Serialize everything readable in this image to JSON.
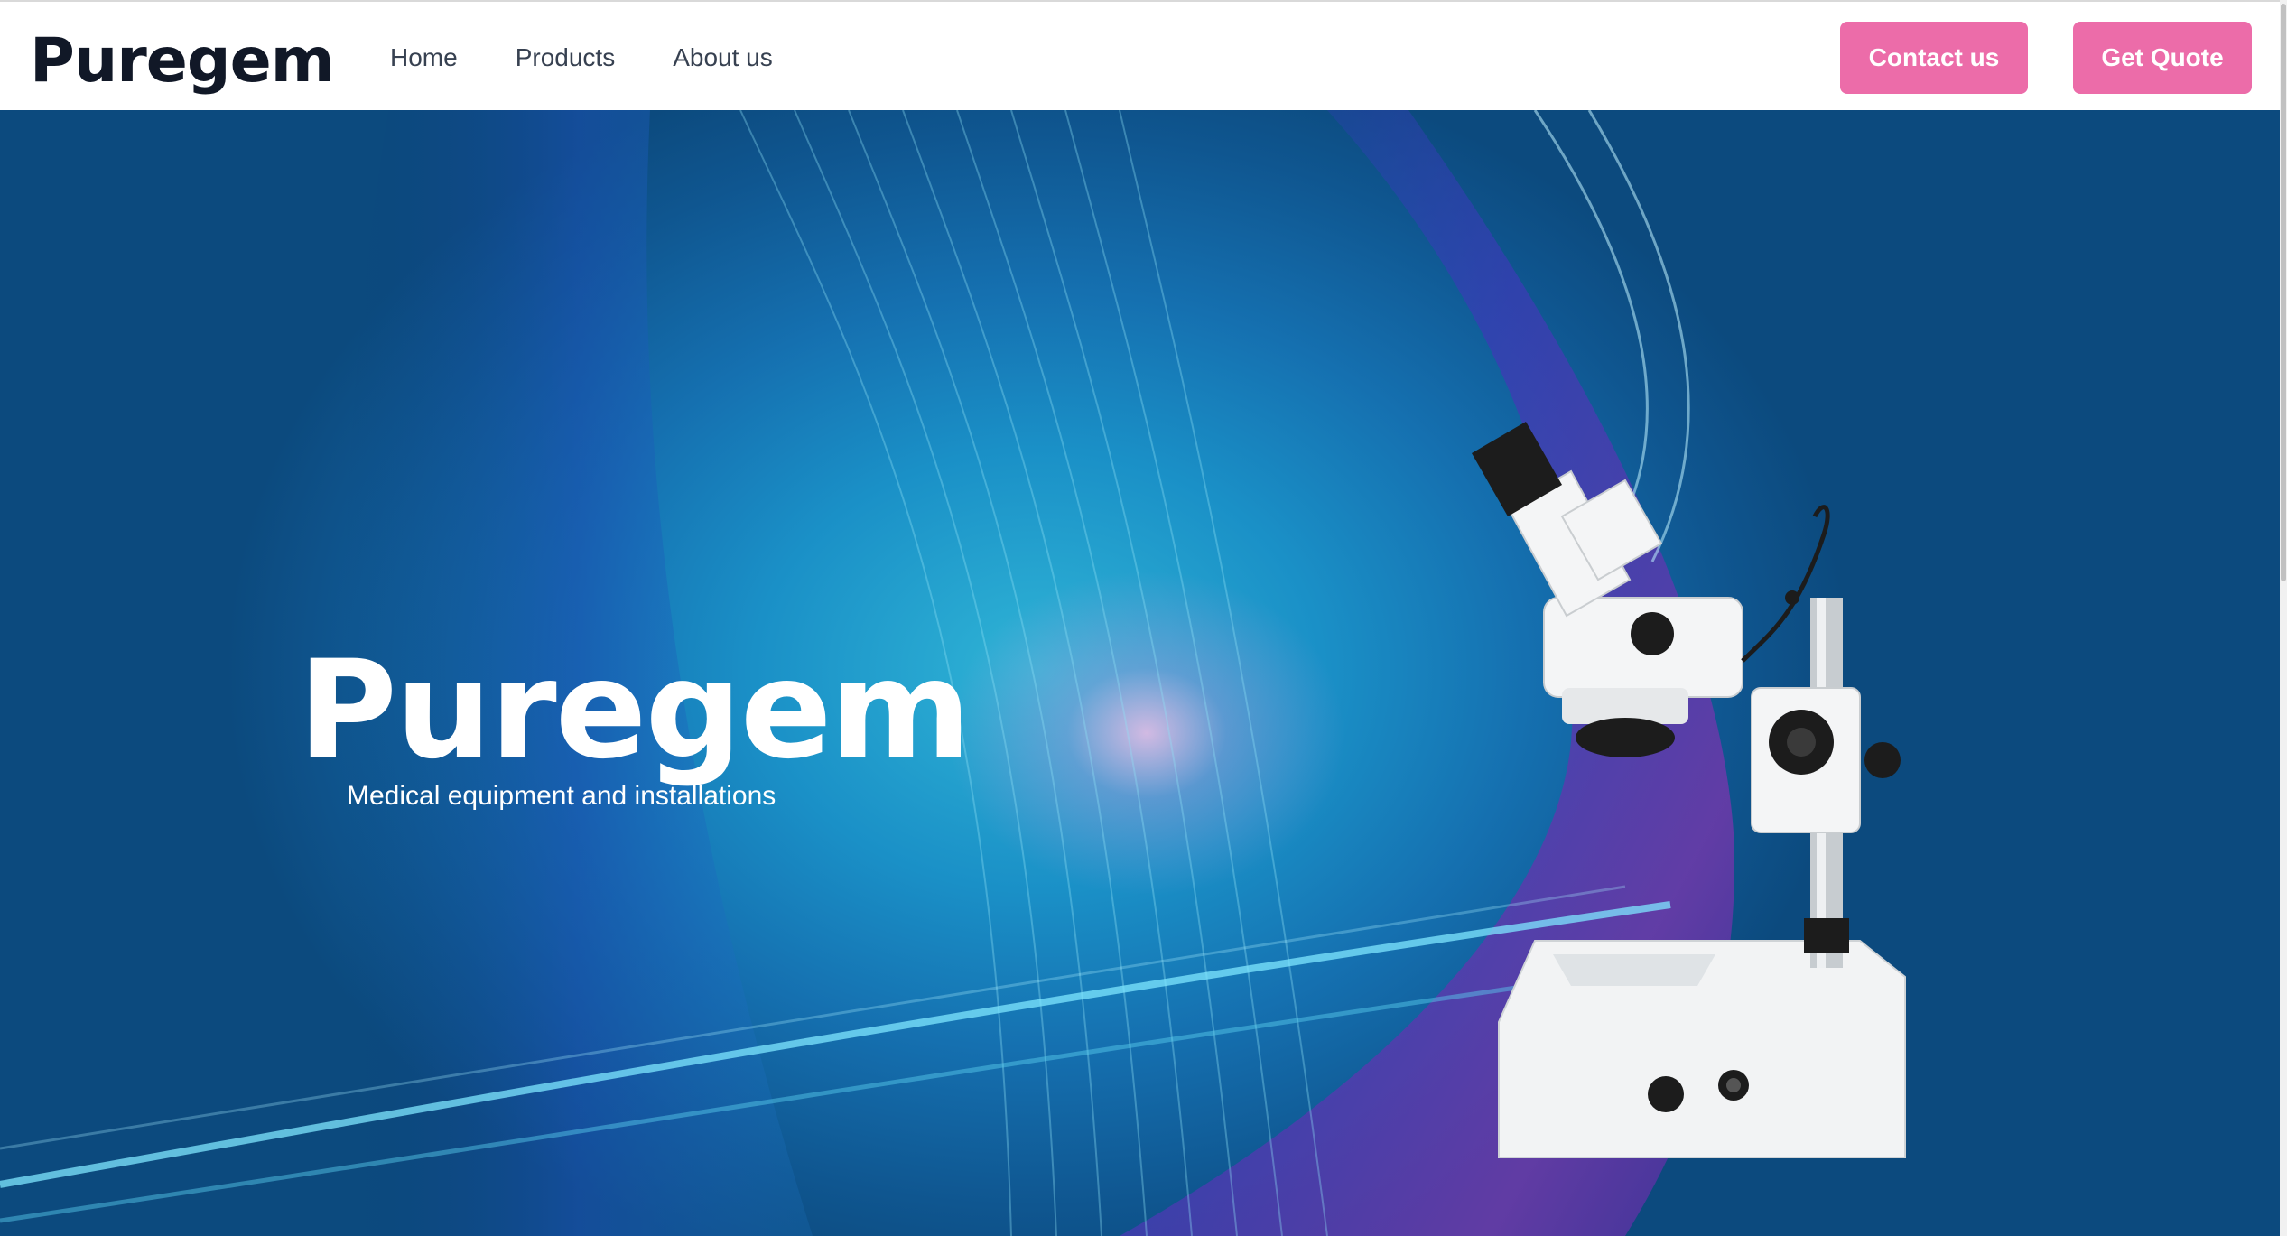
{
  "header": {
    "brand": "Puregem",
    "nav": [
      "Home",
      "Products",
      "About us"
    ],
    "contact_label": "Contact us",
    "quote_label": "Get Quote"
  },
  "hero": {
    "title": "Puregem",
    "subtitle": "Medical equipment and installations"
  },
  "colors": {
    "accent": "#ec6ca9",
    "brand_text": "#111827",
    "nav_text": "#374151",
    "hero_deep": "#0c4a7e",
    "hero_light": "#2fb4d6"
  },
  "icons": {
    "hero_image": "microscope-image"
  }
}
